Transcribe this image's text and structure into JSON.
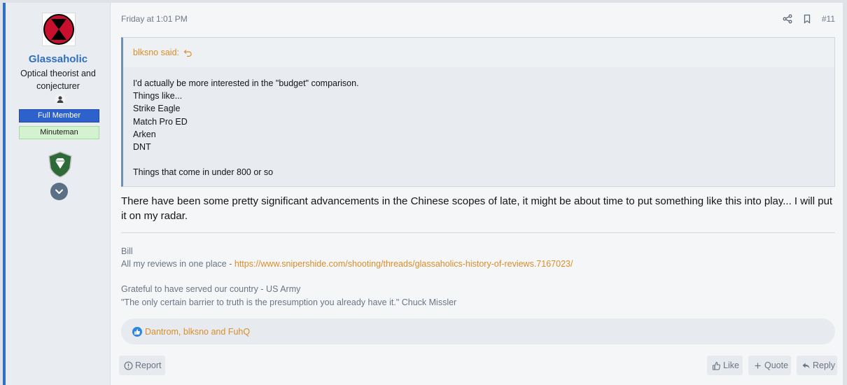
{
  "user": {
    "name": "Glassaholic",
    "title": "Optical theorist and conjecturer",
    "badges": [
      "Full Member",
      "Minuteman"
    ],
    "avatar_icon": "seventh-infantry-hourglass-icon",
    "trophy_icon": "diamond-shield-icon",
    "expand_icon": "chevron-down-icon"
  },
  "post": {
    "time": "Friday at 1:01 PM",
    "number": "#11",
    "quote": {
      "author_label": "blksno said:",
      "lines": [
        "I'd actually be more interested in the \"budget\" comparison.",
        "Things like...",
        "Strike Eagle",
        "Match Pro ED",
        "Arken",
        "DNT",
        "",
        "Things that come in under 800 or so"
      ]
    },
    "message": "There have been some pretty significant advancements in the Chinese scopes of late, it might be about time to put something like this into play... I will put it on my radar.",
    "signature": {
      "name": "Bill",
      "reviews_prefix": "All my reviews in one place - ",
      "reviews_link": "https://www.snipershide.com/shooting/threads/glassaholics-history-of-reviews.7167023/",
      "line3": "Grateful to have served our country - US Army",
      "line4": "\"The only certain barrier to truth is the presumption you already have it.\" Chuck Missler"
    },
    "reactions_text": "Dantrom, blksno and FuhQ"
  },
  "actions": {
    "report": "Report",
    "like": "Like",
    "quote": "Quote",
    "reply": "Reply"
  },
  "colors": {
    "accent": "#2f6fc4",
    "link": "#d98d28",
    "badge_blue": "#2d62cc",
    "badge_green": "#d3f2cf"
  }
}
